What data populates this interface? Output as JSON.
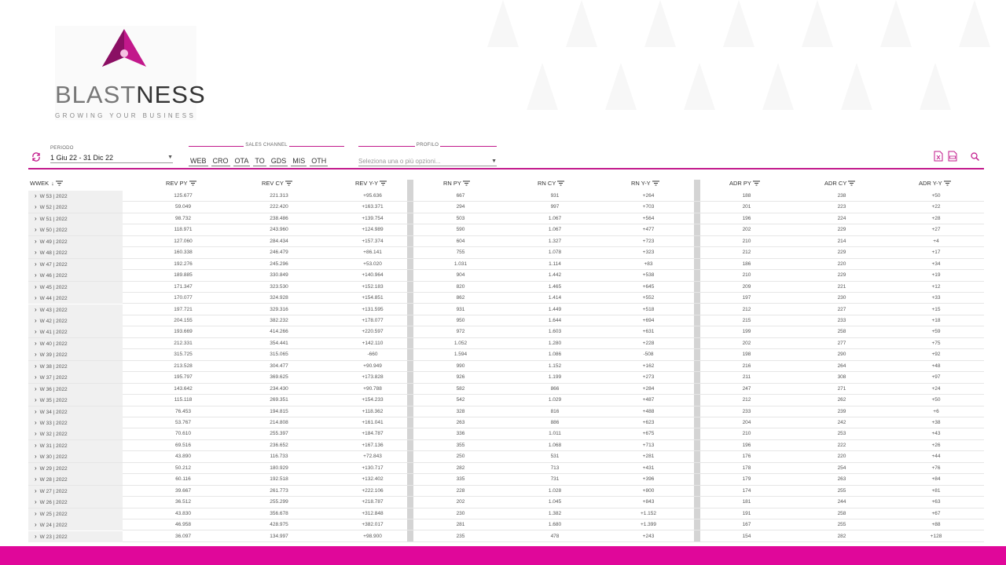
{
  "brand": {
    "name_light": "BLAST",
    "name_dark": "NESS",
    "tagline": "GROWING YOUR BUSINESS",
    "accent": "#c2188b",
    "footer_color": "#e0079a"
  },
  "filters": {
    "periodo_label": "PERIODO",
    "periodo_value": "1 Giu 22 - 31 Dic 22",
    "channel_label": "SALES CHANNEL",
    "channels": [
      "WEB",
      "CRO",
      "OTA",
      "TO",
      "GDS",
      "MIS",
      "OTH"
    ],
    "profilo_label": "PROFILO",
    "profilo_placeholder": "Seleziona una o più opzioni..."
  },
  "table": {
    "columns": [
      "WWEK",
      "REV PY",
      "REV CY",
      "REV Y-Y",
      "RN PY",
      "RN CY",
      "RN Y-Y",
      "ADR PY",
      "ADR CY",
      "ADR Y-Y"
    ],
    "sort_indicator": "↓",
    "rows": [
      [
        "W 53 | 2022",
        "125.677",
        "221.313",
        "+95.636",
        "667",
        "931",
        "+264",
        "188",
        "238",
        "+50"
      ],
      [
        "W 52 | 2022",
        "59.049",
        "222.420",
        "+163.371",
        "294",
        "997",
        "+703",
        "201",
        "223",
        "+22"
      ],
      [
        "W 51 | 2022",
        "98.732",
        "238.486",
        "+139.754",
        "503",
        "1.067",
        "+564",
        "196",
        "224",
        "+28"
      ],
      [
        "W 50 | 2022",
        "118.971",
        "243.960",
        "+124.989",
        "590",
        "1.067",
        "+477",
        "202",
        "229",
        "+27"
      ],
      [
        "W 49 | 2022",
        "127.060",
        "284.434",
        "+157.374",
        "604",
        "1.327",
        "+723",
        "210",
        "214",
        "+4"
      ],
      [
        "W 48 | 2022",
        "160.338",
        "246.479",
        "+86.141",
        "755",
        "1.078",
        "+323",
        "212",
        "229",
        "+17"
      ],
      [
        "W 47 | 2022",
        "192.276",
        "245.296",
        "+53.020",
        "1.031",
        "1.114",
        "+83",
        "186",
        "220",
        "+34"
      ],
      [
        "W 46 | 2022",
        "189.885",
        "330.849",
        "+140.964",
        "904",
        "1.442",
        "+538",
        "210",
        "229",
        "+19"
      ],
      [
        "W 45 | 2022",
        "171.347",
        "323.530",
        "+152.183",
        "820",
        "1.465",
        "+645",
        "209",
        "221",
        "+12"
      ],
      [
        "W 44 | 2022",
        "170.077",
        "324.928",
        "+154.851",
        "862",
        "1.414",
        "+552",
        "197",
        "230",
        "+33"
      ],
      [
        "W 43 | 2022",
        "197.721",
        "329.316",
        "+131.595",
        "931",
        "1.449",
        "+518",
        "212",
        "227",
        "+15"
      ],
      [
        "W 42 | 2022",
        "204.155",
        "382.232",
        "+178.077",
        "950",
        "1.644",
        "+694",
        "215",
        "233",
        "+18"
      ],
      [
        "W 41 | 2022",
        "193.669",
        "414.266",
        "+220.597",
        "972",
        "1.603",
        "+631",
        "199",
        "258",
        "+59"
      ],
      [
        "W 40 | 2022",
        "212.331",
        "354.441",
        "+142.110",
        "1.052",
        "1.280",
        "+228",
        "202",
        "277",
        "+75"
      ],
      [
        "W 39 | 2022",
        "315.725",
        "315.065",
        "-660",
        "1.594",
        "1.086",
        "-508",
        "198",
        "290",
        "+92"
      ],
      [
        "W 38 | 2022",
        "213.528",
        "304.477",
        "+90.949",
        "990",
        "1.152",
        "+162",
        "216",
        "264",
        "+48"
      ],
      [
        "W 37 | 2022",
        "195.797",
        "369.625",
        "+173.828",
        "926",
        "1.199",
        "+273",
        "211",
        "308",
        "+97"
      ],
      [
        "W 36 | 2022",
        "143.642",
        "234.430",
        "+90.788",
        "582",
        "866",
        "+284",
        "247",
        "271",
        "+24"
      ],
      [
        "W 35 | 2022",
        "115.118",
        "269.351",
        "+154.233",
        "542",
        "1.029",
        "+487",
        "212",
        "262",
        "+50"
      ],
      [
        "W 34 | 2022",
        "76.453",
        "194.815",
        "+118.362",
        "328",
        "816",
        "+488",
        "233",
        "239",
        "+6"
      ],
      [
        "W 33 | 2022",
        "53.767",
        "214.808",
        "+161.041",
        "263",
        "886",
        "+623",
        "204",
        "242",
        "+38"
      ],
      [
        "W 32 | 2022",
        "70.610",
        "255.397",
        "+184.787",
        "336",
        "1.011",
        "+675",
        "210",
        "253",
        "+43"
      ],
      [
        "W 31 | 2022",
        "69.516",
        "236.652",
        "+167.136",
        "355",
        "1.068",
        "+713",
        "196",
        "222",
        "+26"
      ],
      [
        "W 30 | 2022",
        "43.890",
        "116.733",
        "+72.843",
        "250",
        "531",
        "+281",
        "176",
        "220",
        "+44"
      ],
      [
        "W 29 | 2022",
        "50.212",
        "180.929",
        "+130.717",
        "282",
        "713",
        "+431",
        "178",
        "254",
        "+76"
      ],
      [
        "W 28 | 2022",
        "60.116",
        "192.518",
        "+132.402",
        "335",
        "731",
        "+396",
        "179",
        "263",
        "+84"
      ],
      [
        "W 27 | 2022",
        "39.667",
        "261.773",
        "+222.106",
        "228",
        "1.028",
        "+800",
        "174",
        "255",
        "+81"
      ],
      [
        "W 26 | 2022",
        "36.512",
        "255.299",
        "+218.787",
        "202",
        "1.045",
        "+843",
        "181",
        "244",
        "+63"
      ],
      [
        "W 25 | 2022",
        "43.830",
        "356.678",
        "+312.848",
        "230",
        "1.382",
        "+1.152",
        "191",
        "258",
        "+67"
      ],
      [
        "W 24 | 2022",
        "46.958",
        "428.975",
        "+382.017",
        "281",
        "1.680",
        "+1.399",
        "167",
        "255",
        "+88"
      ],
      [
        "W 23 | 2022",
        "36.097",
        "134.997",
        "+98.900",
        "235",
        "478",
        "+243",
        "154",
        "282",
        "+128"
      ]
    ]
  }
}
